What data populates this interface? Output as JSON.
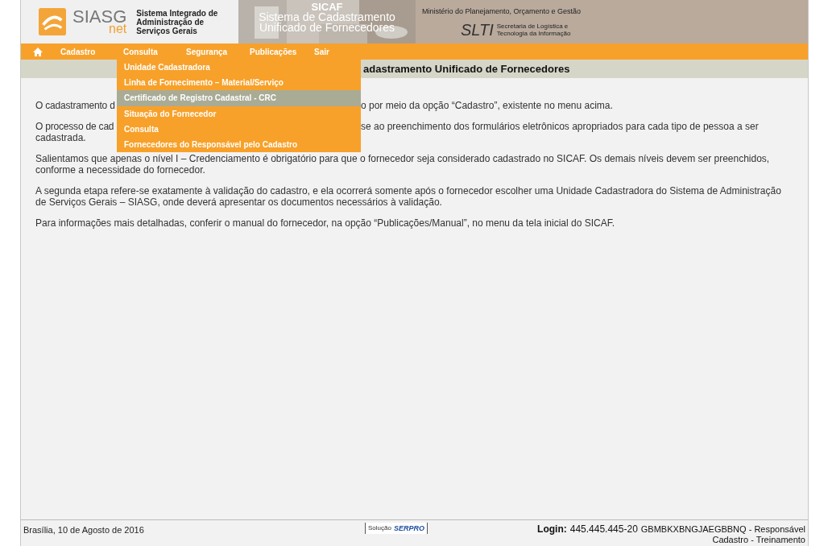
{
  "header": {
    "logo": "SIASG",
    "logo_sub": "net",
    "system_name": [
      "Sistema Integrado de",
      "Administração de",
      "Serviços Gerais"
    ],
    "banner_title": "SICAF",
    "banner_subtitle": [
      "Sistema de Cadastramento",
      "Unificado de Fornecedores"
    ],
    "ministry": "Ministério do Planejamento, Orçamento e Gestão",
    "slti": "SLTI",
    "secretariat": [
      "Secretaria de Logística e",
      "Tecnologia da Informação"
    ]
  },
  "menu": [
    {
      "label": "Cadastro"
    },
    {
      "label": "Consulta"
    },
    {
      "label": "Segurança"
    },
    {
      "label": "Publicações"
    },
    {
      "label": "Sair"
    }
  ],
  "dropdown": [
    {
      "label": "Unidade Cadastradora",
      "selected": false
    },
    {
      "label": "Linha de Fornecimento – Material/Serviço",
      "selected": false
    },
    {
      "label": "Certificado de Registro Cadastral - CRC",
      "selected": true
    },
    {
      "label": "Situação do Fornecedor",
      "selected": false
    },
    {
      "label": "Consulta",
      "selected": false
    },
    {
      "label": "Fornecedores do Responsável pelo Cadastro",
      "selected": false
    }
  ],
  "page_title": "adastramento Unificado de Fornecedores",
  "paragraphs": [
    {
      "kind": "covered",
      "left": "O cadastramento d",
      "right": "o por meio da opção “Cadastro”, existente no menu acima."
    },
    {
      "kind": "covered",
      "left": "O processo de cad",
      "right": "se ao preenchimento dos formulários eletrônicos apropriados para cada tipo de pessoa a ser",
      "rest": "cadastrada."
    },
    {
      "kind": "full",
      "text": "Salientamos que apenas o nível I – Credenciamento é obrigatório para que o fornecedor seja considerado cadastrado no SICAF. Os demais níveis devem ser preenchidos, conforme a necessidade do fornecedor."
    },
    {
      "kind": "full",
      "text": "A segunda etapa refere-se exatamente à validação do cadastro, e ela ocorrerá somente após o fornecedor escolher uma Unidade Cadastradora do Sistema de Administração de Serviços Gerais – SIASG, onde deverá apresentar os documentos necessários à validação."
    },
    {
      "kind": "full",
      "text": "Para informações mais detalhadas, conferir o manual do fornecedor, na opção “Publicações/Manual”, no menu da tela inicial do SICAF."
    }
  ],
  "footer": {
    "date": "Brasília, 10 de Agosto de 2016",
    "badge_label": "Solução",
    "badge_brand": "SERPRO",
    "login_label": "Login:",
    "login_value": "445.445.445-20",
    "user": "GBMBKXBNGJAEGBBNQ - Responsável",
    "role": "Cadastro - Treinamento"
  }
}
